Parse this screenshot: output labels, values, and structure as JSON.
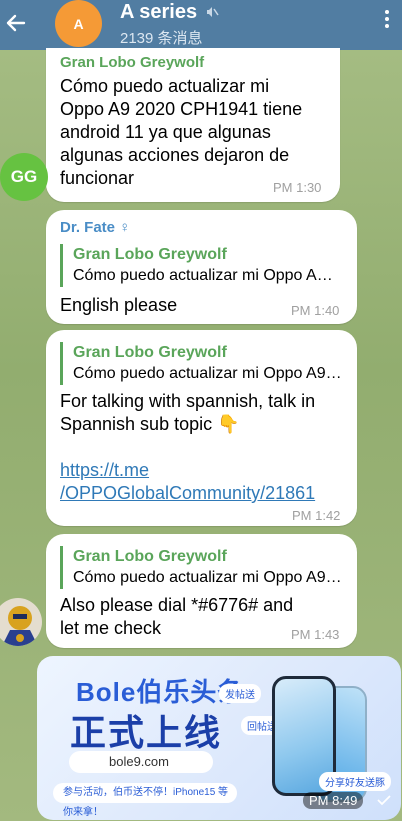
{
  "header": {
    "avatar_letter": "A",
    "title": "A series",
    "subtitle": "2139 条消息"
  },
  "messages": [
    {
      "sender": "Gran Lobo Greywolf",
      "avatar": "GG",
      "text_lines": [
        "Cómo puedo actualizar mi",
        "Oppo A9 2020 CPH1941 tiene",
        "android 11 ya que algunas",
        "algunas acciones dejaron de",
        "funcionar"
      ],
      "time": "PM 1:30"
    },
    {
      "sender": "Dr. Fate ♀",
      "reply_name": "Gran Lobo Greywolf",
      "reply_text": "Cómo puedo actualizar mi Oppo A…",
      "text": "English please",
      "time": "PM 1:40"
    },
    {
      "reply_name": "Gran Lobo Greywolf",
      "reply_text": "Cómo puedo actualizar mi Oppo A9…",
      "text_lines": [
        "For talking with spannish, talk in",
        "Spannish sub topic 👇"
      ],
      "link_lines": [
        "https://t.me",
        "/OPPOGlobalCommunity/21861"
      ],
      "time": "PM 1:42"
    },
    {
      "reply_name": "Gran Lobo Greywolf",
      "reply_text": "Cómo puedo actualizar mi Oppo A9…",
      "text_lines": [
        "Also please dial *#6776# and",
        "let me check"
      ],
      "time": "PM 1:43"
    }
  ],
  "ad": {
    "brand": "Bole伯乐头条",
    "headline": "正式上线",
    "url": "bole9.com",
    "note": "参与活动，伯币送不停！iPhone15 等你来拿！",
    "tag1": "发帖送",
    "tag2": "回帖送",
    "tag3": "分享好友送豚",
    "time": "PM 8:49"
  },
  "colors": {
    "header_bg": "#517da2",
    "sender_green": "#5aa55a",
    "sender_blue": "#4a8dc6",
    "link": "#2f79b7"
  }
}
